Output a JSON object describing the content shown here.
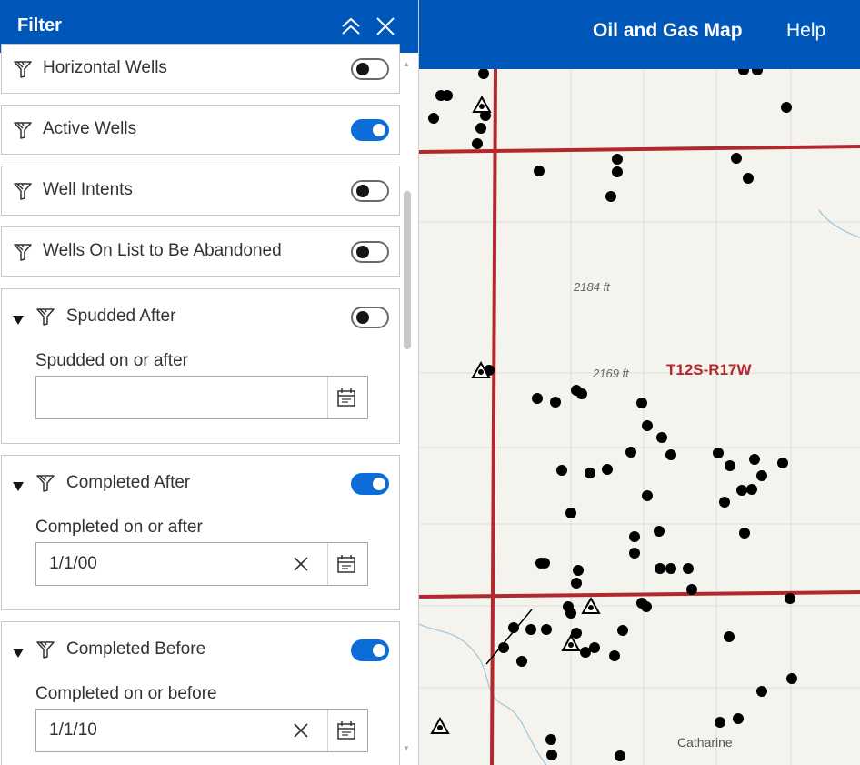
{
  "appbar": {
    "title": "Oil and Gas Map",
    "help_label": "Help"
  },
  "panel": {
    "title": "Filter",
    "collapse_icon": "double-chevron-up-icon",
    "close_icon": "close-icon"
  },
  "filters": [
    {
      "label": "Horizontal Wells",
      "enabled": false
    },
    {
      "label": "Active Wells",
      "enabled": true
    },
    {
      "label": "Well Intents",
      "enabled": false
    },
    {
      "label": "Wells On List to Be Abandoned",
      "enabled": false
    },
    {
      "label": "Spudded After",
      "enabled": false,
      "field_label": "Spudded on or after",
      "value": ""
    },
    {
      "label": "Completed After",
      "enabled": true,
      "field_label": "Completed on or after",
      "value": "1/1/00"
    },
    {
      "label": "Completed Before",
      "enabled": true,
      "field_label": "Completed on or before",
      "value": "1/1/10"
    }
  ],
  "map": {
    "township_label": "T12S-R17W",
    "elevation_1": "2184 ft",
    "elevation_2": "2169 ft",
    "town_label": "Catharine",
    "colors": {
      "section_line": "#b3282d",
      "township_label": "#b3282d",
      "well_dot": "#000000"
    }
  }
}
